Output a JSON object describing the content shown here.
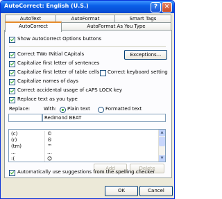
{
  "window": {
    "title": "AutoCorrect: English (U.S.)",
    "minimize_glyph": "?",
    "close_glyph": "✕"
  },
  "tabs": {
    "row1": [
      "AutoText",
      "AutoFormat",
      "Smart Tags"
    ],
    "row2": [
      "AutoCorrect",
      "AutoFormat As You Type"
    ],
    "active": "AutoCorrect"
  },
  "options": {
    "show_buttons": {
      "label": "Show AutoCorrect Options buttons",
      "checked": true
    },
    "two_initial": {
      "label": "Correct TWo INitial CApitals",
      "checked": true
    },
    "first_sentence": {
      "label": "Capitalize first letter of sentences",
      "checked": true
    },
    "first_table": {
      "label": "Capitalize first letter of table cells",
      "checked": true
    },
    "keyboard": {
      "label": "Correct keyboard setting",
      "checked": false
    },
    "names_days": {
      "label": "Capitalize names of days",
      "checked": true
    },
    "caps_lock": {
      "label": "Correct accidental usage of cAPS LOCK key",
      "checked": true
    },
    "replace_text": {
      "label": "Replace text as you type",
      "checked": true
    },
    "suggestions": {
      "label": "Automatically use suggestions from the spelling checker",
      "checked": true
    }
  },
  "buttons": {
    "exceptions": "Exceptions...",
    "add": "Add",
    "delete": "Delete",
    "ok": "OK",
    "cancel": "Cancel"
  },
  "replace": {
    "replace_label": "Replace:",
    "with_label": "With:",
    "plain_text": "Plain text",
    "formatted_text": "Formatted text",
    "replace_value": "",
    "with_value": "Redmond BEAT"
  },
  "list": {
    "rows": [
      {
        "from": "(c)",
        "to": "©"
      },
      {
        "from": "(r)",
        "to": "®"
      },
      {
        "from": "(tm)",
        "to": "™"
      },
      {
        "from": "...",
        "to": "…"
      },
      {
        "from": ":(",
        "to": "☹"
      }
    ]
  },
  "icons": {
    "minimize": "minimize-icon",
    "close": "close-icon",
    "scroll_up": "scroll-up-icon",
    "scroll_down": "scroll-down-icon"
  },
  "colors": {
    "titlebar": "#0a5fe8",
    "tab_active_accent": "#e68b2c",
    "check": "#21a121",
    "dialog_bg": "#ece9d8"
  }
}
